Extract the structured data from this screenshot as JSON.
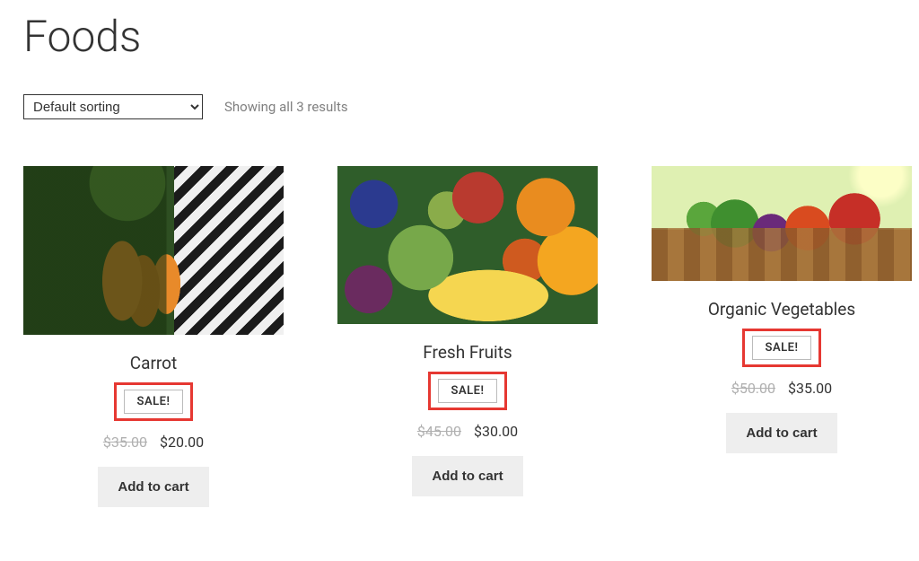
{
  "page_title": "Foods",
  "sorting": {
    "selected": "Default sorting",
    "options": [
      "Default sorting"
    ]
  },
  "result_count_text": "Showing all 3 results",
  "sale_label": "SALE!",
  "add_to_cart_label": "Add to cart",
  "products": [
    {
      "name": "Carrot",
      "old_price": "$35.00",
      "new_price": "$20.00",
      "image_kind": "carrot"
    },
    {
      "name": "Fresh Fruits",
      "old_price": "$45.00",
      "new_price": "$30.00",
      "image_kind": "fruits"
    },
    {
      "name": "Organic Vegetables",
      "old_price": "$50.00",
      "new_price": "$35.00",
      "image_kind": "vegetables"
    }
  ]
}
